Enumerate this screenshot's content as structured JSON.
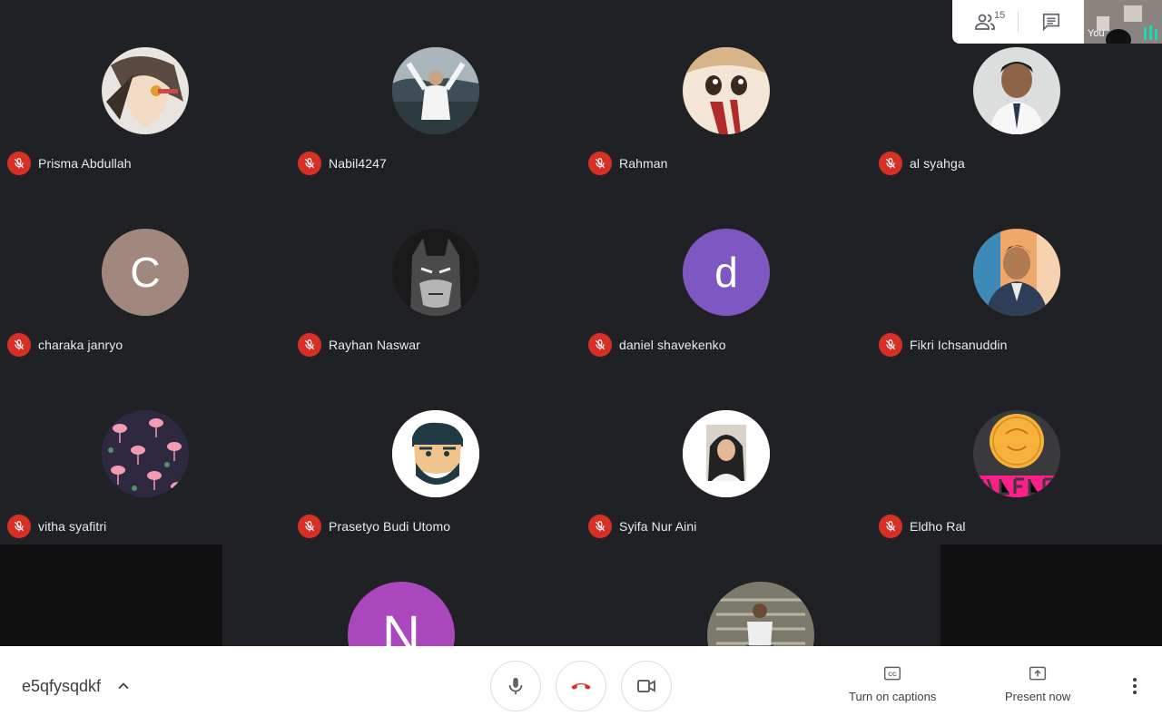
{
  "participants": [
    {
      "name": "Prisma Abdullah",
      "avatar": "anime-boy-photo"
    },
    {
      "name": "Nabil4247",
      "avatar": "person-lake-photo"
    },
    {
      "name": "Rahman",
      "avatar": "anime-face-photo"
    },
    {
      "name": "al syahga",
      "avatar": "person-suit-photo"
    },
    {
      "name": "charaka janryo",
      "initial": "C",
      "color": "#a1887f"
    },
    {
      "name": "Rayhan Naswar",
      "avatar": "batman-photo"
    },
    {
      "name": "daniel shavekenko",
      "initial": "d",
      "color": "#7e57c2"
    },
    {
      "name": "Fikri Ichsanuddin",
      "avatar": "person-blazer-photo"
    },
    {
      "name": "vitha syafitri",
      "avatar": "flamingo-pattern"
    },
    {
      "name": "Prasetyo Budi Utomo",
      "avatar": "bearded-cartoon"
    },
    {
      "name": "Syifa Nur Aini",
      "avatar": "hijab-photo"
    },
    {
      "name": "Eldho Ral",
      "avatar": "pink-logo"
    }
  ],
  "partial_row": [
    {
      "initial": "N",
      "color": "#ab47bc"
    },
    {
      "avatar": "person-stairs-photo"
    }
  ],
  "top_panel": {
    "participant_count": "15",
    "self_label": "You"
  },
  "bottom_bar": {
    "meeting_code": "e5qfysqdkf",
    "captions_label": "Turn on captions",
    "present_label": "Present now"
  },
  "colors": {
    "background": "#202124",
    "mute_badge": "#d93025",
    "hangup": "#d93025"
  }
}
